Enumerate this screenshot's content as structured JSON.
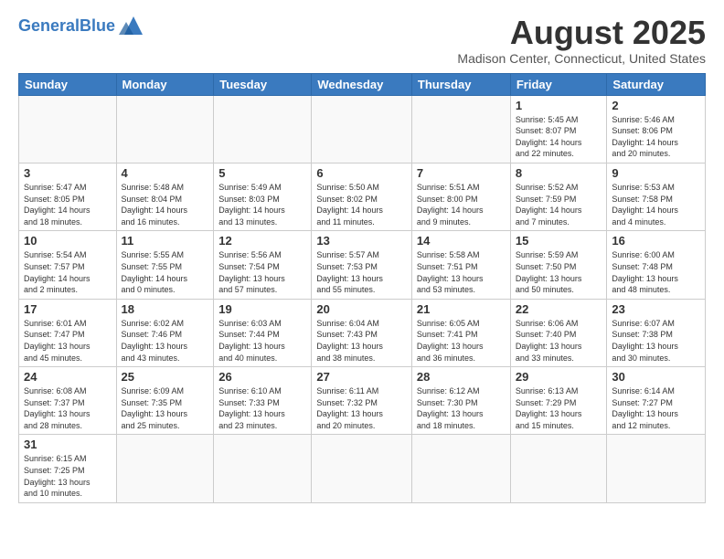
{
  "header": {
    "logo_general": "General",
    "logo_blue": "Blue",
    "month_year": "August 2025",
    "location": "Madison Center, Connecticut, United States"
  },
  "days_of_week": [
    "Sunday",
    "Monday",
    "Tuesday",
    "Wednesday",
    "Thursday",
    "Friday",
    "Saturday"
  ],
  "weeks": [
    [
      {
        "day": "",
        "info": ""
      },
      {
        "day": "",
        "info": ""
      },
      {
        "day": "",
        "info": ""
      },
      {
        "day": "",
        "info": ""
      },
      {
        "day": "",
        "info": ""
      },
      {
        "day": "1",
        "info": "Sunrise: 5:45 AM\nSunset: 8:07 PM\nDaylight: 14 hours\nand 22 minutes."
      },
      {
        "day": "2",
        "info": "Sunrise: 5:46 AM\nSunset: 8:06 PM\nDaylight: 14 hours\nand 20 minutes."
      }
    ],
    [
      {
        "day": "3",
        "info": "Sunrise: 5:47 AM\nSunset: 8:05 PM\nDaylight: 14 hours\nand 18 minutes."
      },
      {
        "day": "4",
        "info": "Sunrise: 5:48 AM\nSunset: 8:04 PM\nDaylight: 14 hours\nand 16 minutes."
      },
      {
        "day": "5",
        "info": "Sunrise: 5:49 AM\nSunset: 8:03 PM\nDaylight: 14 hours\nand 13 minutes."
      },
      {
        "day": "6",
        "info": "Sunrise: 5:50 AM\nSunset: 8:02 PM\nDaylight: 14 hours\nand 11 minutes."
      },
      {
        "day": "7",
        "info": "Sunrise: 5:51 AM\nSunset: 8:00 PM\nDaylight: 14 hours\nand 9 minutes."
      },
      {
        "day": "8",
        "info": "Sunrise: 5:52 AM\nSunset: 7:59 PM\nDaylight: 14 hours\nand 7 minutes."
      },
      {
        "day": "9",
        "info": "Sunrise: 5:53 AM\nSunset: 7:58 PM\nDaylight: 14 hours\nand 4 minutes."
      }
    ],
    [
      {
        "day": "10",
        "info": "Sunrise: 5:54 AM\nSunset: 7:57 PM\nDaylight: 14 hours\nand 2 minutes."
      },
      {
        "day": "11",
        "info": "Sunrise: 5:55 AM\nSunset: 7:55 PM\nDaylight: 14 hours\nand 0 minutes."
      },
      {
        "day": "12",
        "info": "Sunrise: 5:56 AM\nSunset: 7:54 PM\nDaylight: 13 hours\nand 57 minutes."
      },
      {
        "day": "13",
        "info": "Sunrise: 5:57 AM\nSunset: 7:53 PM\nDaylight: 13 hours\nand 55 minutes."
      },
      {
        "day": "14",
        "info": "Sunrise: 5:58 AM\nSunset: 7:51 PM\nDaylight: 13 hours\nand 53 minutes."
      },
      {
        "day": "15",
        "info": "Sunrise: 5:59 AM\nSunset: 7:50 PM\nDaylight: 13 hours\nand 50 minutes."
      },
      {
        "day": "16",
        "info": "Sunrise: 6:00 AM\nSunset: 7:48 PM\nDaylight: 13 hours\nand 48 minutes."
      }
    ],
    [
      {
        "day": "17",
        "info": "Sunrise: 6:01 AM\nSunset: 7:47 PM\nDaylight: 13 hours\nand 45 minutes."
      },
      {
        "day": "18",
        "info": "Sunrise: 6:02 AM\nSunset: 7:46 PM\nDaylight: 13 hours\nand 43 minutes."
      },
      {
        "day": "19",
        "info": "Sunrise: 6:03 AM\nSunset: 7:44 PM\nDaylight: 13 hours\nand 40 minutes."
      },
      {
        "day": "20",
        "info": "Sunrise: 6:04 AM\nSunset: 7:43 PM\nDaylight: 13 hours\nand 38 minutes."
      },
      {
        "day": "21",
        "info": "Sunrise: 6:05 AM\nSunset: 7:41 PM\nDaylight: 13 hours\nand 36 minutes."
      },
      {
        "day": "22",
        "info": "Sunrise: 6:06 AM\nSunset: 7:40 PM\nDaylight: 13 hours\nand 33 minutes."
      },
      {
        "day": "23",
        "info": "Sunrise: 6:07 AM\nSunset: 7:38 PM\nDaylight: 13 hours\nand 30 minutes."
      }
    ],
    [
      {
        "day": "24",
        "info": "Sunrise: 6:08 AM\nSunset: 7:37 PM\nDaylight: 13 hours\nand 28 minutes."
      },
      {
        "day": "25",
        "info": "Sunrise: 6:09 AM\nSunset: 7:35 PM\nDaylight: 13 hours\nand 25 minutes."
      },
      {
        "day": "26",
        "info": "Sunrise: 6:10 AM\nSunset: 7:33 PM\nDaylight: 13 hours\nand 23 minutes."
      },
      {
        "day": "27",
        "info": "Sunrise: 6:11 AM\nSunset: 7:32 PM\nDaylight: 13 hours\nand 20 minutes."
      },
      {
        "day": "28",
        "info": "Sunrise: 6:12 AM\nSunset: 7:30 PM\nDaylight: 13 hours\nand 18 minutes."
      },
      {
        "day": "29",
        "info": "Sunrise: 6:13 AM\nSunset: 7:29 PM\nDaylight: 13 hours\nand 15 minutes."
      },
      {
        "day": "30",
        "info": "Sunrise: 6:14 AM\nSunset: 7:27 PM\nDaylight: 13 hours\nand 12 minutes."
      }
    ],
    [
      {
        "day": "31",
        "info": "Sunrise: 6:15 AM\nSunset: 7:25 PM\nDaylight: 13 hours\nand 10 minutes."
      },
      {
        "day": "",
        "info": ""
      },
      {
        "day": "",
        "info": ""
      },
      {
        "day": "",
        "info": ""
      },
      {
        "day": "",
        "info": ""
      },
      {
        "day": "",
        "info": ""
      },
      {
        "day": "",
        "info": ""
      }
    ]
  ]
}
